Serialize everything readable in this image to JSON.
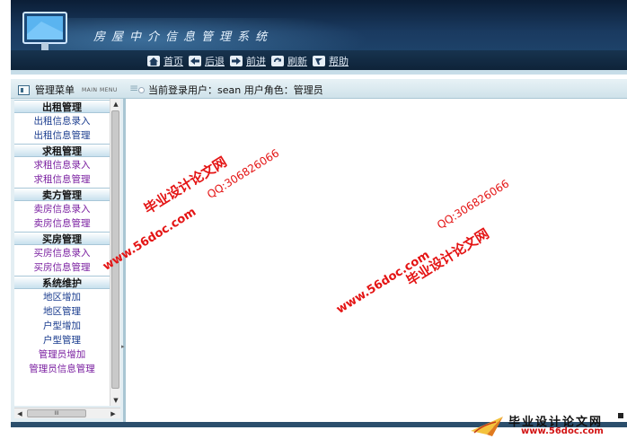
{
  "header": {
    "title": "房屋中介信息管理系统",
    "nav": [
      {
        "label": "首页",
        "icon": "home-icon"
      },
      {
        "label": "后退",
        "icon": "back-arrow-icon"
      },
      {
        "label": "前进",
        "icon": "forward-arrow-icon"
      },
      {
        "label": "刷新",
        "icon": "refresh-icon"
      },
      {
        "label": "帮助",
        "icon": "help-icon"
      }
    ]
  },
  "infobar": {
    "menu_title": "管理菜单",
    "menu_subtitle": "MAIN MENU",
    "user_info": "当前登录用户：sean 用户角色：管理员"
  },
  "sidebar": {
    "groups": [
      {
        "title": "出租管理",
        "items": [
          {
            "label": "出租信息录入"
          },
          {
            "label": "出租信息管理"
          }
        ]
      },
      {
        "title": "求租管理",
        "items": [
          {
            "label": "求租信息录入"
          },
          {
            "label": "求租信息管理"
          }
        ]
      },
      {
        "title": "卖方管理",
        "items": [
          {
            "label": "卖房信息录入"
          },
          {
            "label": "卖房信息管理"
          }
        ]
      },
      {
        "title": "买房管理",
        "items": [
          {
            "label": "买房信息录入"
          },
          {
            "label": "买房信息管理"
          }
        ]
      },
      {
        "title": "系统维护",
        "items": [
          {
            "label": "地区增加"
          },
          {
            "label": "地区管理"
          },
          {
            "label": "户型增加"
          },
          {
            "label": "户型管理"
          },
          {
            "label": "管理员增加"
          },
          {
            "label": "管理员信息管理"
          }
        ]
      }
    ],
    "hscroll_thumb": "III"
  },
  "watermark": {
    "cn": "毕业设计论文网",
    "qq": "QQ:306826066",
    "url": "www.56doc.com"
  },
  "logo": {
    "cn": "毕业设计论文网",
    "url": "www.56doc.com"
  },
  "colors": {
    "header_dark": "#0b1e36",
    "link": "#1b3d8f",
    "link_visited": "#7a1fa0",
    "watermark": "#e41414"
  }
}
